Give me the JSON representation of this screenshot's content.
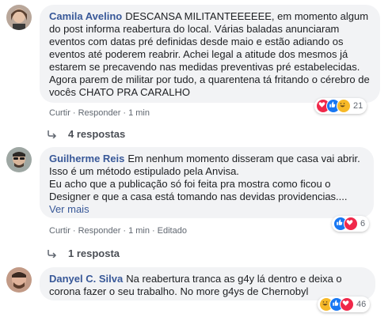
{
  "comments": [
    {
      "author": "Camila Avelino",
      "text": "DESCANSA MILITANTEEEEEE, em momento algum do post informa reabertura do local. Várias baladas anunciaram eventos com datas pré definidas desde maio e estão adiando os eventos até poderem reabrir. Achei legal a atitude dos mesmos já estarem se precavendo nas medidas preventivas pré estabelecidas. Agora parem de militar por tudo, a quarentena tá fritando o cérebro de vocês CHATO PRA CARALHO",
      "reactions": [
        "love",
        "like",
        "haha"
      ],
      "reaction_count": "21",
      "actions": {
        "reply": "Curtir",
        "respond": "Responder",
        "time": "1 min"
      },
      "replies_label": "4 respostas"
    },
    {
      "author": "Guilherme Reis",
      "text": "Em nenhum momento disseram que casa vai abrir. Isso é um método estipulado pela Anvisa.\nEu acho que a publicação só foi feita pra mostra como ficou o Designer e que a casa está tomando nas devidas providencias....",
      "see_more": "Ver mais",
      "reactions": [
        "like",
        "love"
      ],
      "reaction_count": "6",
      "actions": {
        "reply": "Curtir",
        "respond": "Responder",
        "time": "1 min",
        "edited": "Editado"
      },
      "replies_label": "1 resposta"
    },
    {
      "author": "Danyel C. Silva",
      "text": "Na reabertura tranca as g4y lá dentro e deixa o corona fazer o seu trabalho. No more g4ys de Chernobyl",
      "reactions": [
        "haha",
        "like",
        "love"
      ],
      "reaction_count": "46"
    }
  ],
  "colors": {
    "link": "#385898",
    "bubble": "#f2f3f5",
    "meta": "#606770"
  }
}
